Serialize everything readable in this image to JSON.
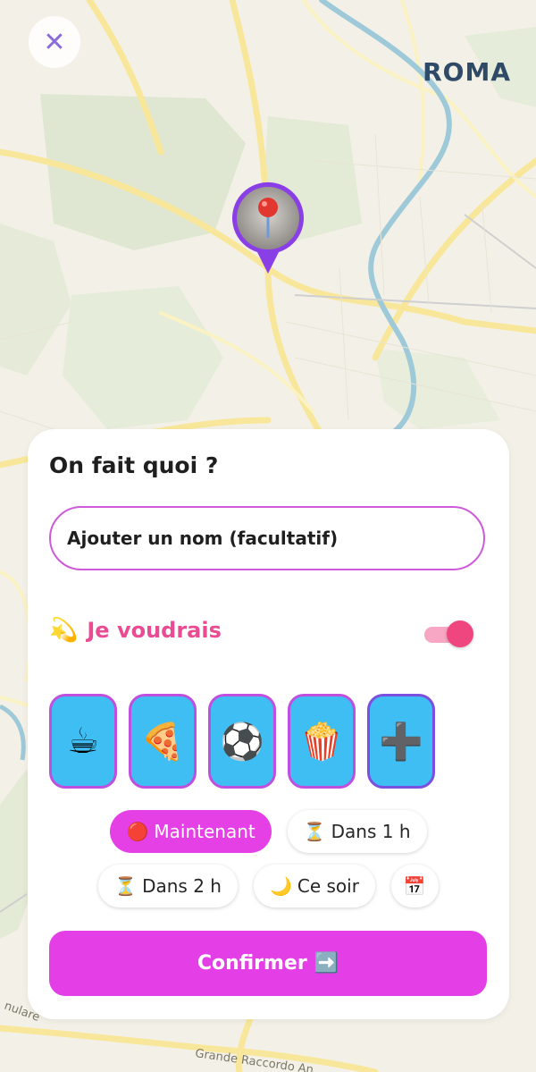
{
  "map": {
    "city": "ROMA",
    "streets": [
      {
        "name": "Grande Raccordo Anulare",
        "parts": [
          "nulare",
          "Grande Raccordo An"
        ]
      }
    ]
  },
  "header": {
    "close_icon": "close-icon",
    "close_glyph": "✕"
  },
  "card": {
    "title": "On fait quoi ?",
    "name_placeholder": "Ajouter un nom (facultatif)",
    "wish": {
      "icon": "💫",
      "label": "Je voudrais",
      "toggle_on": true
    },
    "activities": [
      {
        "name": "coffee-icon",
        "glyph": "☕"
      },
      {
        "name": "pizza-icon",
        "glyph": "🍕"
      },
      {
        "name": "soccer-ball-icon",
        "glyph": "⚽"
      },
      {
        "name": "popcorn-icon",
        "glyph": "🍿"
      },
      {
        "name": "plus-icon",
        "glyph": "➕"
      }
    ],
    "times": {
      "now": {
        "icon": "🔴",
        "label": "Maintenant",
        "selected": true
      },
      "in_1h": {
        "icon": "⏳",
        "label": "Dans 1 h"
      },
      "in_2h": {
        "icon": "⏳",
        "label": "Dans 2 h"
      },
      "tonight": {
        "icon": "🌙",
        "label": "Ce soir"
      },
      "calendar": {
        "icon": "📅"
      }
    },
    "confirm": {
      "label": "Confirmer",
      "icon": "➡️"
    }
  },
  "colors": {
    "accent_pink": "#e43fe6",
    "wish_pink": "#ea4c93",
    "activity_blue": "#3fbef4",
    "pin_purple": "#8a3fe6"
  }
}
